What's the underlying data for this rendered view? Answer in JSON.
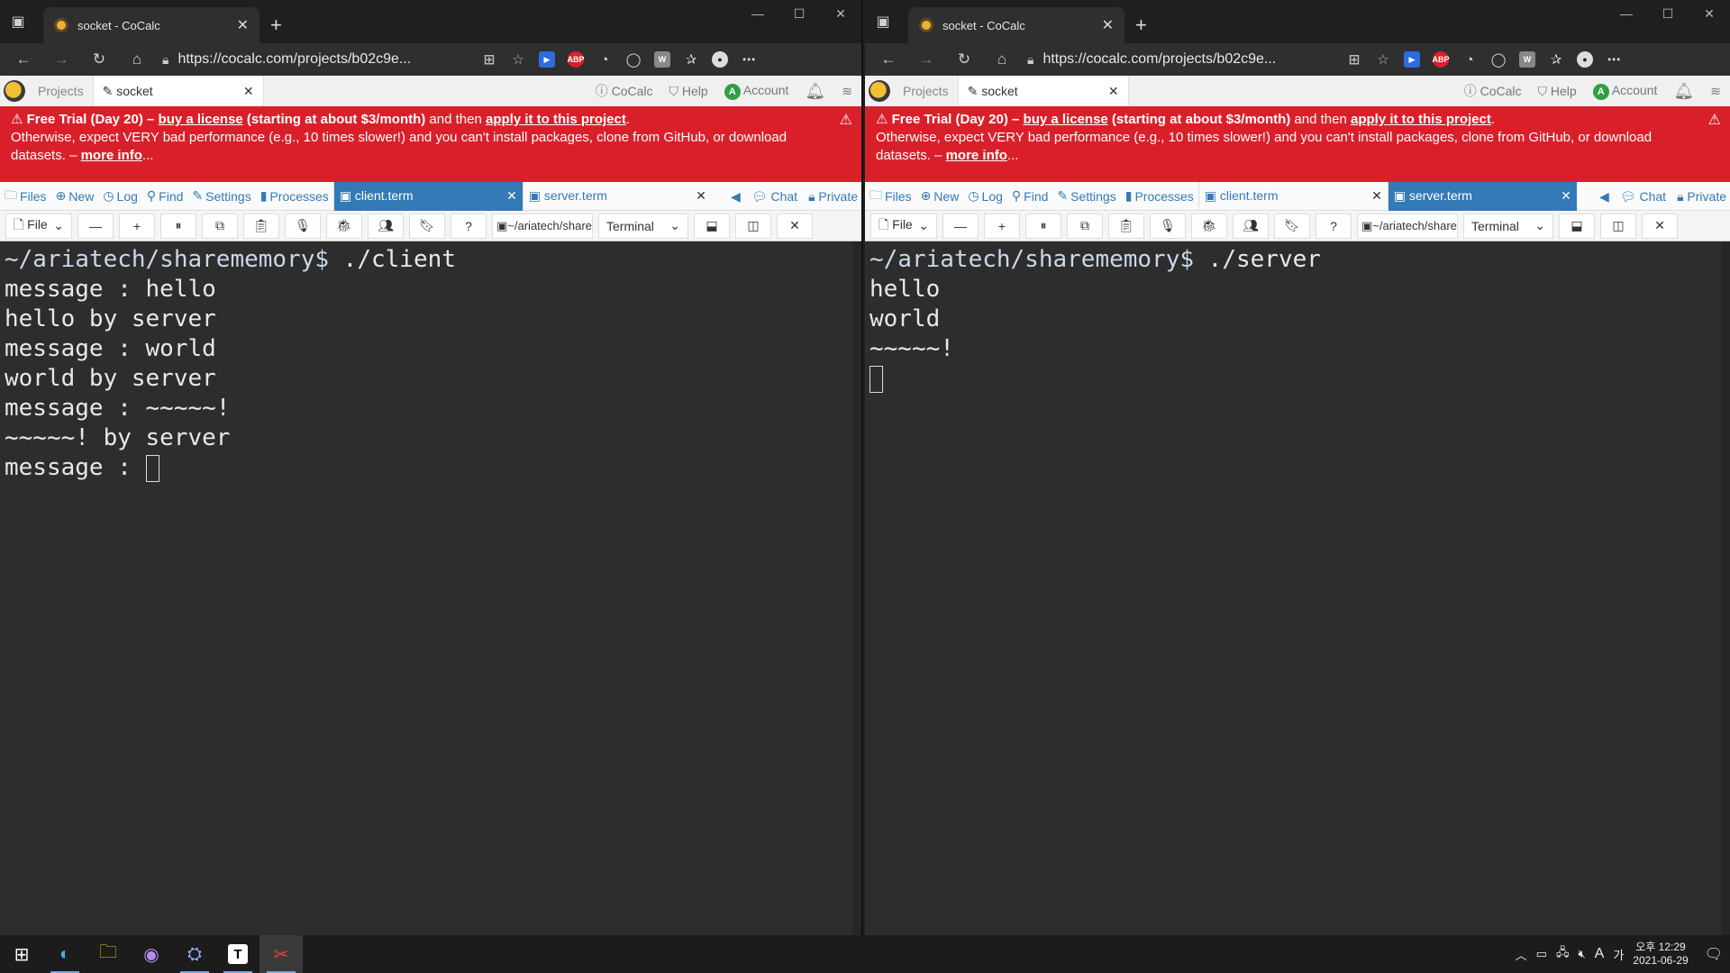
{
  "browser": {
    "tab_title": "socket - CoCalc",
    "url": "https://cocalc.com/projects/b02c9e..."
  },
  "cocalc": {
    "projects_label": "Projects",
    "project_tab": "socket",
    "cocalc_label": "CoCalc",
    "help_label": "Help",
    "account_label": "Account",
    "account_initial": "A"
  },
  "banner": {
    "prefix": "Free Trial (Day 20)",
    "dash": " – ",
    "buy_link": "buy a license",
    "price": " (starting at about $3/month)",
    "and_then": " and then ",
    "apply_link": "apply it to this project",
    "line2": "Otherwise, expect VERY bad performance (e.g., 10 times slower!) and you can't install packages, clone from GitHub, or download",
    "line3_prefix": "datasets. – ",
    "more_link": "more info",
    "ellipsis": "..."
  },
  "filebar": {
    "files": "Files",
    "new": "New",
    "log": "Log",
    "find": "Find",
    "settings": "Settings",
    "processes": "Processes",
    "chat": "Chat",
    "private": "Private"
  },
  "left": {
    "tabs": [
      "client.term",
      "server.term"
    ],
    "active_tab": 0,
    "path": "~/ariatech/share",
    "terminal_kind": "Terminal",
    "file_label": "File",
    "prompt": "~/ariatech/sharememory$",
    "command": " ./client",
    "lines": [
      "message : hello",
      "hello by server",
      "message : world",
      "world by server",
      "message : ~~~~~!",
      "~~~~~! by server"
    ],
    "last_line": "message : "
  },
  "right": {
    "tabs": [
      "client.term",
      "server.term"
    ],
    "active_tab": 1,
    "path": "~/ariatech/share",
    "terminal_kind": "Terminal",
    "file_label": "File",
    "prompt": "~/ariatech/sharememory$",
    "command": " ./server",
    "lines": [
      "hello",
      "world",
      "~~~~~!"
    ]
  },
  "taskbar": {
    "time": "오후 12:29",
    "date": "2021-06-29",
    "ime": "A",
    "lang": "가"
  },
  "colors": {
    "banner_red": "#d9202a",
    "active_tab_blue": "#337ab7",
    "terminal_bg": "#2d2d2d"
  }
}
